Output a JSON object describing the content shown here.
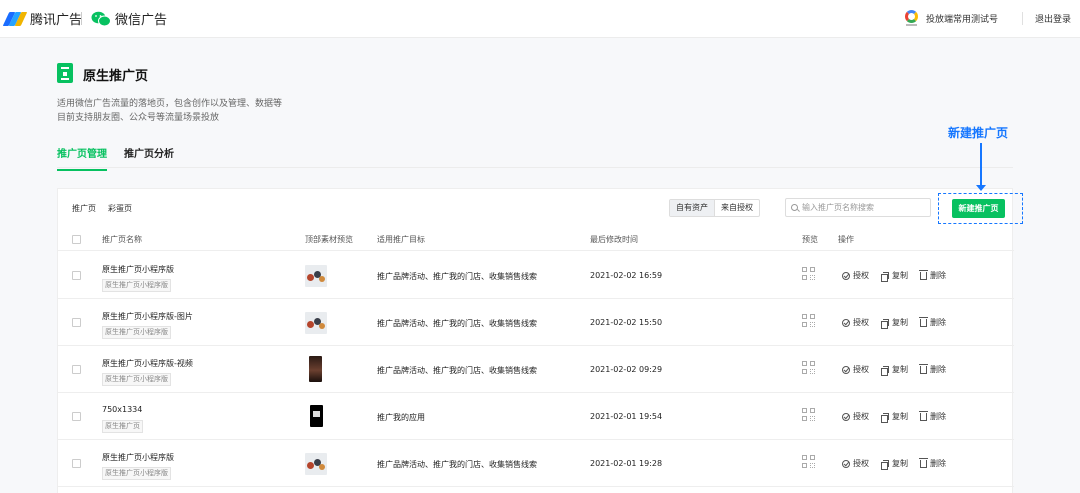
{
  "header": {
    "tencent_label": "腾讯广告",
    "wechat_label": "微信广告",
    "account_name": "投放端常用测试号",
    "logout_label": "退出登录"
  },
  "page": {
    "title": "原生推广页",
    "desc_line1": "适用微信广告流量的落地页，包含创作以及管理、数据等",
    "desc_line2": "目前支持朋友圈、公众号等流量场景投放",
    "tabs": [
      {
        "label": "推广页管理",
        "active": true
      },
      {
        "label": "推广页分析",
        "active": false
      }
    ]
  },
  "annotation": {
    "label": "新建推广页",
    "color": "#1677ff"
  },
  "toolbar": {
    "subtabs": [
      "推广页",
      "彩蛋页"
    ],
    "segment": [
      "自有资产",
      "来自授权"
    ],
    "search_placeholder": "输入推广页名称搜索",
    "new_button": "新建推广页"
  },
  "table": {
    "columns": {
      "name": "推广页名称",
      "top_media": "顶部素材预览",
      "goal": "适用推广目标",
      "modified": "最后修改时间",
      "preview": "预览",
      "actions": "操作"
    },
    "actions": [
      "授权",
      "复制",
      "删除"
    ],
    "rows": [
      {
        "name": "原生推广页小程序版",
        "tag": "原生推广页小程序版",
        "thumb": "food",
        "goal": "推广品牌活动、推广我的门店、收集销售线索",
        "time": "2021-02-02 16:59"
      },
      {
        "name": "原生推广页小程序版-图片",
        "tag": "原生推广页小程序版",
        "thumb": "food",
        "goal": "推广品牌活动、推广我的门店、收集销售线索",
        "time": "2021-02-02 15:50"
      },
      {
        "name": "原生推广页小程序版-视频",
        "tag": "原生推广页小程序版",
        "thumb": "portrait",
        "goal": "推广品牌活动、推广我的门店、收集销售线索",
        "time": "2021-02-02 09:29"
      },
      {
        "name": "750x1334",
        "tag": "原生推广页",
        "thumb": "dark",
        "goal": "推广我的应用",
        "time": "2021-02-01 19:54"
      },
      {
        "name": "原生推广页小程序版",
        "tag": "原生推广页小程序版",
        "thumb": "food",
        "goal": "推广品牌活动、推广我的门店、收集销售线索",
        "time": "2021-02-01 19:28"
      }
    ]
  },
  "colors": {
    "brand_green": "#07c160",
    "accent_blue": "#1677ff"
  }
}
